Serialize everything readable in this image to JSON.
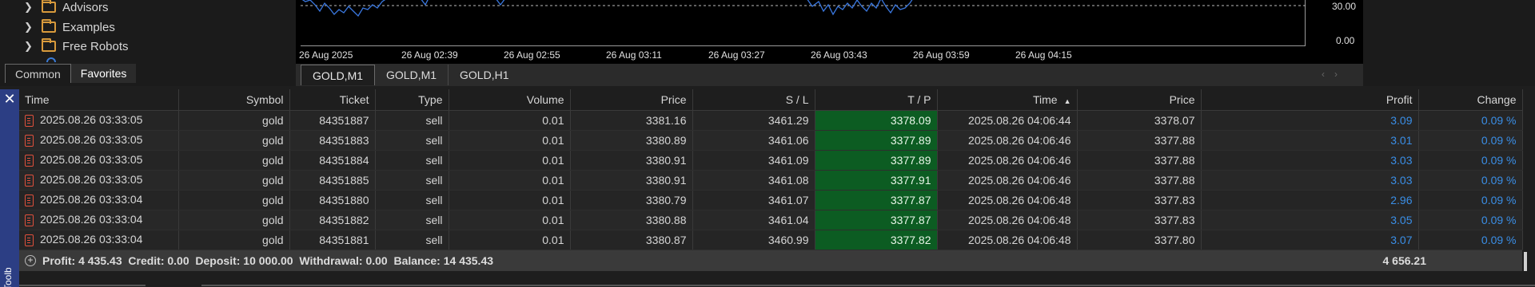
{
  "navigator": {
    "items": [
      {
        "label": "Advisors"
      },
      {
        "label": "Examples"
      },
      {
        "label": "Free Robots"
      }
    ],
    "tabs": [
      "Common",
      "Favorites"
    ],
    "active_tab": "Favorites"
  },
  "chart": {
    "y_ticks": [
      "30.00",
      "0.00"
    ],
    "x_ticks": [
      "26 Aug 2025",
      "26 Aug 02:39",
      "26 Aug 02:55",
      "26 Aug 03:11",
      "26 Aug 03:27",
      "26 Aug 03:43",
      "26 Aug 03:59",
      "26 Aug 04:15"
    ],
    "line_color": "#3a78e0",
    "level_color": "#bbbbbb"
  },
  "chart_tabs": [
    "GOLD,M1",
    "GOLD,M1",
    "GOLD,H1"
  ],
  "table": {
    "columns": [
      "Time",
      "Symbol",
      "Ticket",
      "Type",
      "Volume",
      "Price",
      "S / L",
      "T / P",
      "Time",
      "Price",
      "Profit",
      "Change"
    ],
    "rows": [
      [
        "2025.08.26 03:33:05",
        "gold",
        "84351887",
        "sell",
        "0.01",
        "3381.16",
        "3461.29",
        "3378.09",
        "2025.08.26 04:06:44",
        "3378.07",
        "3.09",
        "0.09 %"
      ],
      [
        "2025.08.26 03:33:05",
        "gold",
        "84351883",
        "sell",
        "0.01",
        "3380.89",
        "3461.06",
        "3377.89",
        "2025.08.26 04:06:46",
        "3377.88",
        "3.01",
        "0.09 %"
      ],
      [
        "2025.08.26 03:33:05",
        "gold",
        "84351884",
        "sell",
        "0.01",
        "3380.91",
        "3461.09",
        "3377.89",
        "2025.08.26 04:06:46",
        "3377.88",
        "3.03",
        "0.09 %"
      ],
      [
        "2025.08.26 03:33:05",
        "gold",
        "84351885",
        "sell",
        "0.01",
        "3380.91",
        "3461.08",
        "3377.91",
        "2025.08.26 04:06:46",
        "3377.88",
        "3.03",
        "0.09 %"
      ],
      [
        "2025.08.26 03:33:04",
        "gold",
        "84351880",
        "sell",
        "0.01",
        "3380.79",
        "3461.07",
        "3377.87",
        "2025.08.26 04:06:48",
        "3377.83",
        "2.96",
        "0.09 %"
      ],
      [
        "2025.08.26 03:33:04",
        "gold",
        "84351882",
        "sell",
        "0.01",
        "3380.88",
        "3461.04",
        "3377.87",
        "2025.08.26 04:06:48",
        "3377.83",
        "3.05",
        "0.09 %"
      ],
      [
        "2025.08.26 03:33:04",
        "gold",
        "84351881",
        "sell",
        "0.01",
        "3380.87",
        "3460.99",
        "3377.82",
        "2025.08.26 04:06:48",
        "3377.80",
        "3.07",
        "0.09 %"
      ]
    ],
    "summary": "Profit: 4 435.43  Credit: 0.00  Deposit: 10 000.00  Withdrawal: 0.00  Balance: 14 435.43",
    "summary_total": "4 656.21",
    "tp_color": "#0c5c22",
    "profit_color": "#3a8ee6"
  },
  "toolbox": {
    "label": "Toolbox"
  }
}
